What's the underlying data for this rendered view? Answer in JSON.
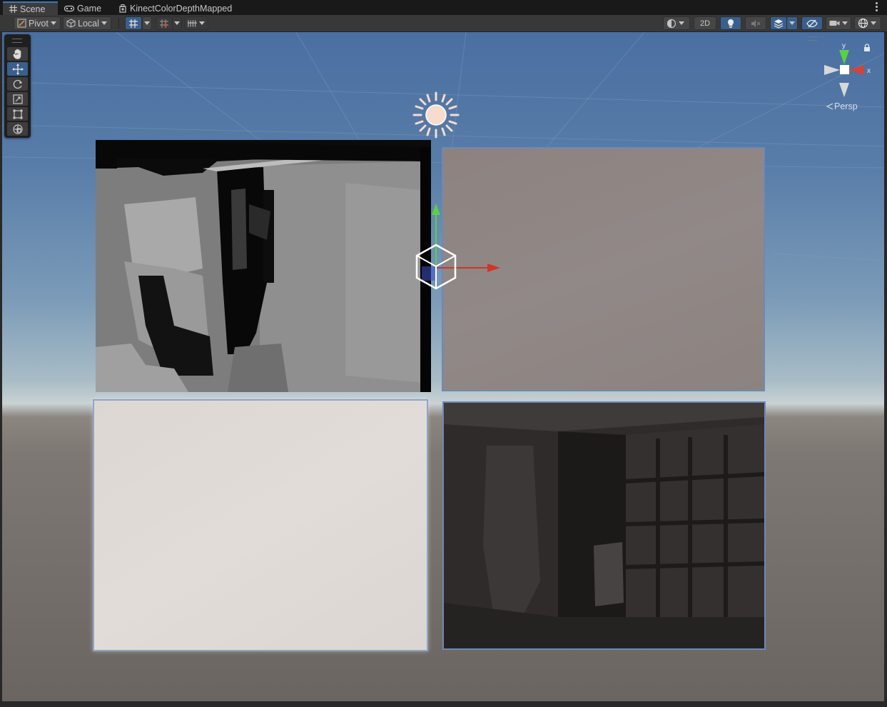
{
  "tabs": [
    {
      "label": "Scene",
      "icon": "grid-hash-icon",
      "active": true
    },
    {
      "label": "Game",
      "icon": "gamepad-icon",
      "active": false
    },
    {
      "label": "KinectColorDepthMapped",
      "icon": "prefab-icon",
      "active": false
    }
  ],
  "toolbar": {
    "pivot_label": "Pivot",
    "local_label": "Local",
    "two_d_label": "2D"
  },
  "scene_view": {
    "camera_mode_label": "Persp",
    "axis_y_label": "y",
    "axis_x_label": "x",
    "accent_color": "#3a79bb",
    "selection_outline_color": "#6d89b5"
  },
  "tools": [
    "hand-tool-icon",
    "move-tool-icon",
    "rotate-tool-icon",
    "scale-tool-icon",
    "rect-tool-icon",
    "transform-tool-icon"
  ],
  "quads": [
    {
      "name": "depth-image-quad",
      "content": "depth map"
    },
    {
      "name": "color-image-quad",
      "content": "blank"
    },
    {
      "name": "body-index-quad",
      "content": "blank"
    },
    {
      "name": "infrared-image-quad",
      "content": "infrared"
    }
  ]
}
